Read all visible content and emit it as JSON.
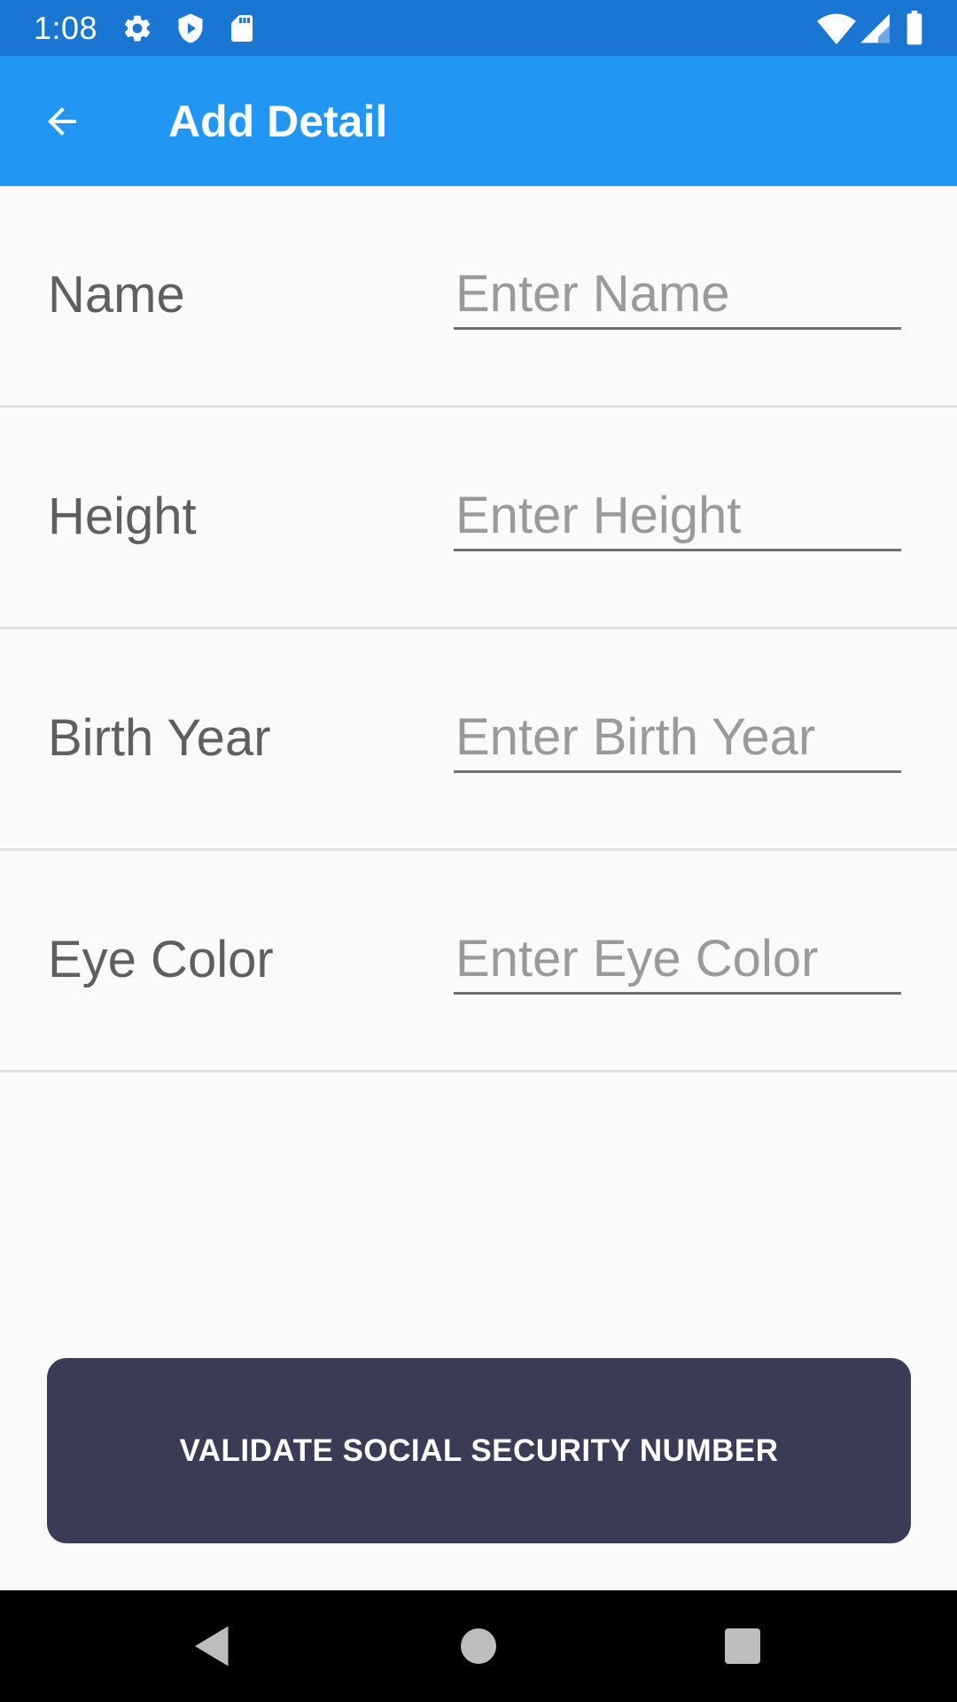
{
  "status_bar": {
    "time": "1:08",
    "left_icons": [
      "gear-icon",
      "shield-play-icon",
      "sd-card-icon"
    ],
    "right_icons": [
      "wifi-icon",
      "cell-signal-icon",
      "battery-icon"
    ],
    "background": "#1976d2"
  },
  "app_bar": {
    "title": "Add Detail",
    "back_icon": "arrow-back-icon",
    "background": "#2196f3"
  },
  "form": {
    "rows": [
      {
        "label": "Name",
        "placeholder": "Enter Name",
        "value": ""
      },
      {
        "label": "Height",
        "placeholder": "Enter Height",
        "value": ""
      },
      {
        "label": "Birth Year",
        "placeholder": "Enter Birth Year",
        "value": ""
      },
      {
        "label": "Eye Color",
        "placeholder": "Enter Eye Color",
        "value": ""
      }
    ]
  },
  "actions": {
    "validate_label": "VALIDATE SOCIAL SECURITY NUMBER",
    "validate_color": "#3a3c56"
  },
  "nav_bar": {
    "icons": [
      "back-triangle-icon",
      "home-circle-icon",
      "recents-square-icon"
    ]
  }
}
